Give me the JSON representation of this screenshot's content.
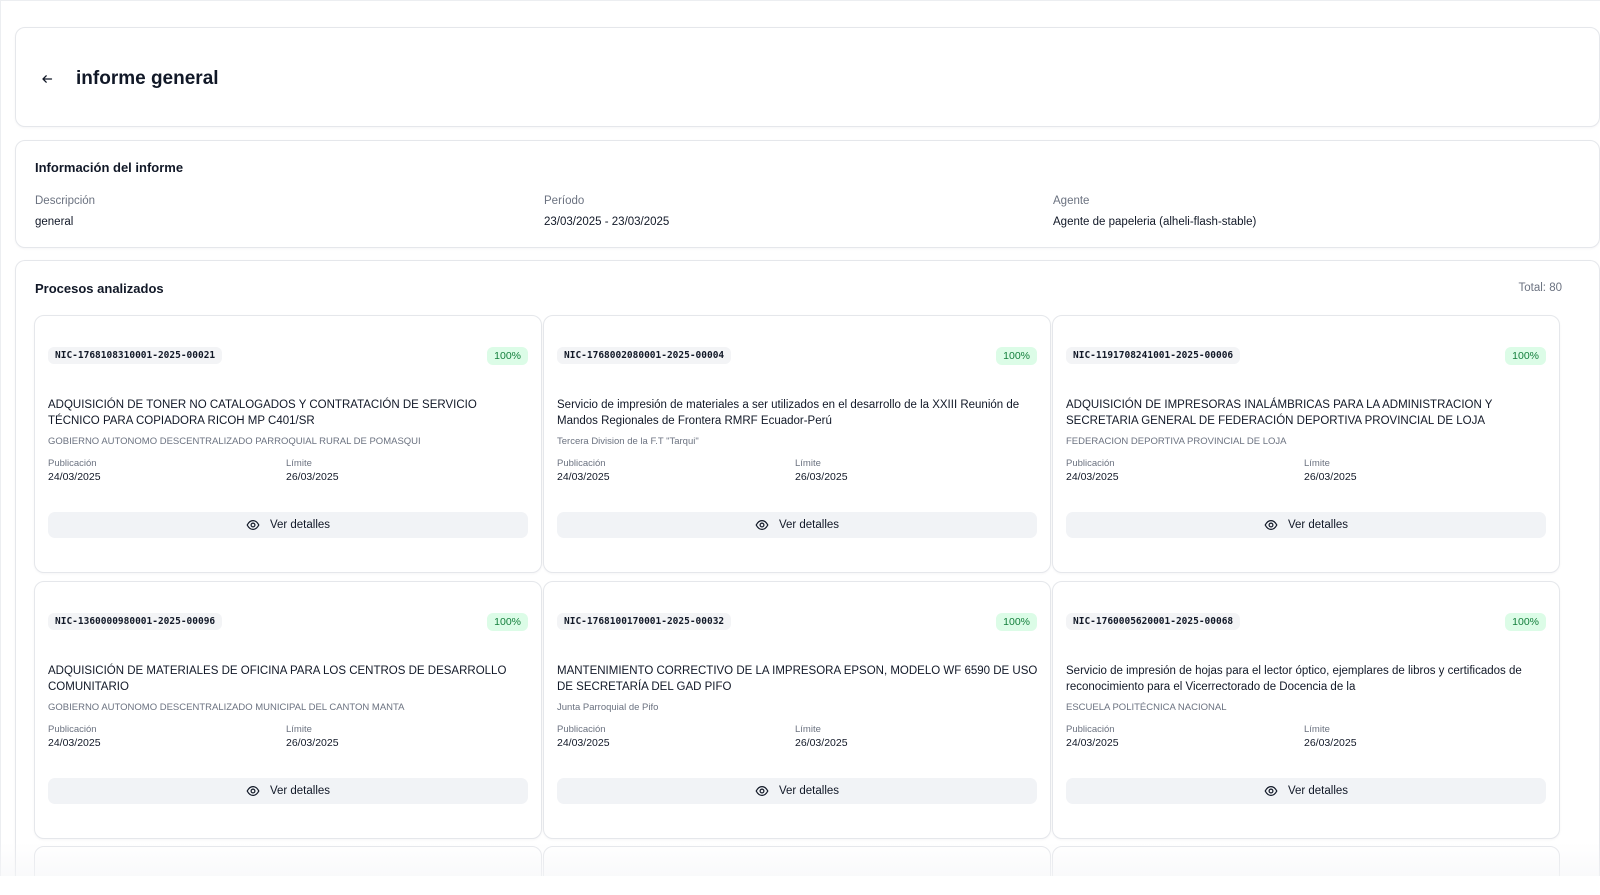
{
  "page": {
    "title": "informe general"
  },
  "info": {
    "section_title": "Información del informe",
    "description_label": "Descripción",
    "description_value": "general",
    "period_label": "Período",
    "period_value": "23/03/2025 - 23/03/2025",
    "agent_label": "Agente",
    "agent_value": "Agente de papeleria (alheli-flash-stable)"
  },
  "processes": {
    "section_title": "Procesos analizados",
    "total": "Total: 80",
    "publication_label": "Publicación",
    "limit_label": "Límite",
    "details_label": "Ver detalles",
    "items": [
      {
        "code": "NIC-1768108310001-2025-00021",
        "score": "100%",
        "title": "ADQUISICIÓN DE TONER NO CATALOGADOS Y CONTRATACIÓN DE SERVICIO TÉCNICO PARA COPIADORA RICOH MP C401/SR",
        "org": "GOBIERNO AUTONOMO DESCENTRALIZADO PARROQUIAL RURAL DE POMASQUI",
        "publication": "24/03/2025",
        "limit": "26/03/2025"
      },
      {
        "code": "NIC-1768002080001-2025-00004",
        "score": "100%",
        "title": "Servicio de impresión de materiales a ser utilizados en el desarrollo de la XXIII Reunión de Mandos Regionales de Frontera RMRF Ecuador-Perú",
        "org": "Tercera Division de la F.T \"Tarqui\"",
        "publication": "24/03/2025",
        "limit": "26/03/2025"
      },
      {
        "code": "NIC-1191708241001-2025-00006",
        "score": "100%",
        "title": "ADQUISICIÓN DE IMPRESORAS INALÁMBRICAS PARA LA ADMINISTRACION Y SECRETARIA GENERAL DE FEDERACIÓN DEPORTIVA PROVINCIAL DE LOJA",
        "org": "FEDERACION DEPORTIVA PROVINCIAL DE LOJA",
        "publication": "24/03/2025",
        "limit": "26/03/2025"
      },
      {
        "code": "NIC-1360000980001-2025-00096",
        "score": "100%",
        "title": "ADQUISICIÓN DE MATERIALES DE OFICINA PARA LOS CENTROS DE DESARROLLO COMUNITARIO",
        "org": "GOBIERNO AUTONOMO DESCENTRALIZADO MUNICIPAL DEL CANTON MANTA",
        "publication": "24/03/2025",
        "limit": "26/03/2025"
      },
      {
        "code": "NIC-1768100170001-2025-00032",
        "score": "100%",
        "title": "MANTENIMIENTO CORRECTIVO DE LA IMPRESORA EPSON, MODELO WF 6590 DE USO DE SECRETARÍA DEL GAD PIFO",
        "org": "Junta Parroquial de Pifo",
        "publication": "24/03/2025",
        "limit": "26/03/2025"
      },
      {
        "code": "NIC-1760005620001-2025-00068",
        "score": "100%",
        "title": "Servicio de impresión de hojas para el lector óptico, ejemplares de libros y certificados de reconocimiento para el Vicerrectorado de Docencia de la",
        "org": "ESCUELA POLITÉCNICA NACIONAL",
        "publication": "24/03/2025",
        "limit": "26/03/2025"
      }
    ]
  },
  "icons": {
    "back": "arrow-left-icon",
    "details": "eye-icon"
  },
  "colors": {
    "score_bg": "#dcfce7",
    "score_text": "#15803d",
    "button_bg": "#f1f3f6"
  }
}
